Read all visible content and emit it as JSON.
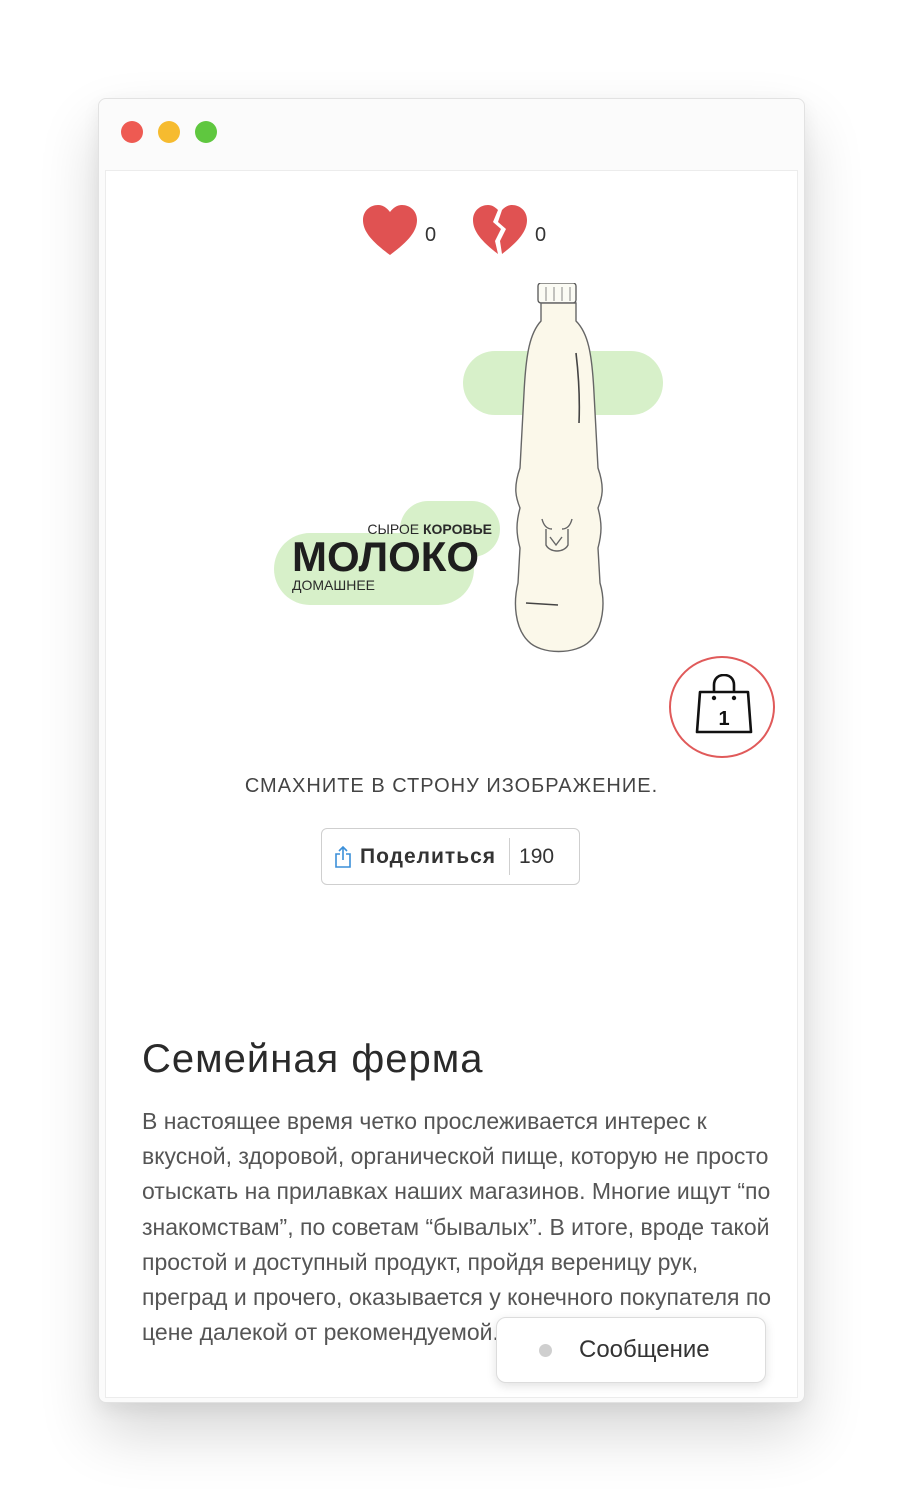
{
  "window": {
    "controls": [
      "close",
      "minimize",
      "zoom"
    ]
  },
  "reactions": {
    "likes": "0",
    "dislikes": "0"
  },
  "product": {
    "logo_top_prefix": "СЫРОЕ",
    "logo_top_bold": "КОРОВЬЕ",
    "logo_main": "МОЛОКО",
    "logo_bottom": "ДОМАШНЕЕ",
    "cart_count": "1"
  },
  "hint": "СМАХНИТЕ В СТРОНУ ИЗОБРАЖЕНИЕ.",
  "share": {
    "label": "Поделиться",
    "count": "190"
  },
  "section": {
    "title": "Семейная ферма",
    "text": "В настоящее время четко прослеживается интерес к вкусной, здоровой, органической пище, которую не просто отыскать на прилавках наших магазинов. Многие ищут “по знакомствам”, по советам “бывалых”. В итоге, вроде такой простой и доступный продукт, пройдя вереницу рук, преград и прочего, оказывается у конечного покупателя по цене далекой от рекомендуемой."
  },
  "message_button": {
    "label": "Сообщение"
  },
  "colors": {
    "heart": "#e05252",
    "blob": "#d7f0c9",
    "bag_border": "#e05a5a",
    "share_icon": "#3b8fd9"
  },
  "icons": [
    "heart-icon",
    "broken-heart-icon",
    "shopping-bag-icon",
    "share-icon"
  ]
}
